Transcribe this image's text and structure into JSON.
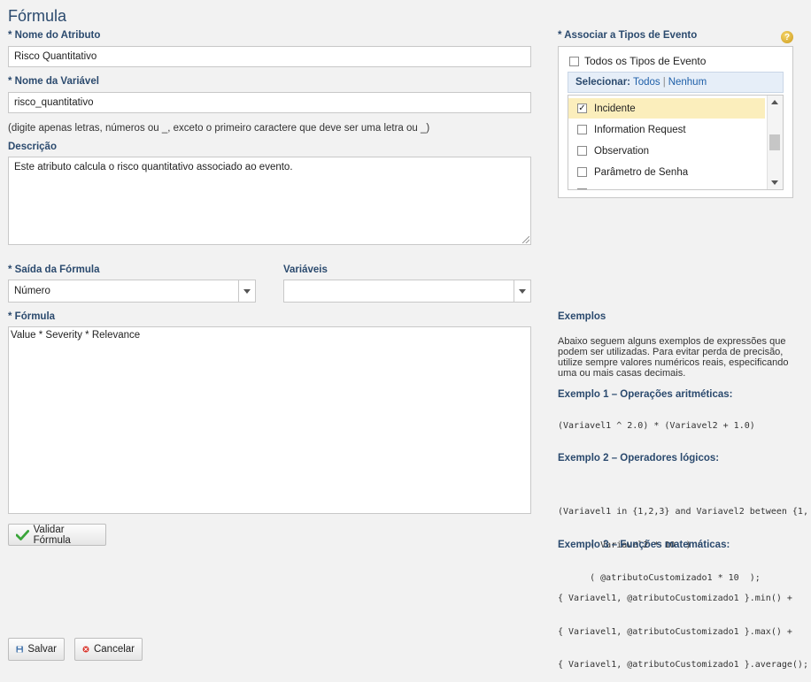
{
  "page": {
    "title": "Fórmula"
  },
  "attr_name": {
    "label": "* Nome do Atributo",
    "value": "Risco Quantitativo"
  },
  "var_name": {
    "label": "* Nome da Variável",
    "value": "risco_quantitativo",
    "hint": "(digite apenas letras, números ou _, exceto o primeiro caractere que deve ser uma letra ou _)"
  },
  "description": {
    "label": "Descrição",
    "value": "Este atributo calcula o risco quantitativo associado ao evento."
  },
  "output": {
    "label": "* Saída da Fórmula",
    "value": "Número"
  },
  "variables": {
    "label": "Variáveis",
    "value": ""
  },
  "formula": {
    "label": "* Fórmula",
    "value": "Value * Severity * Relevance"
  },
  "validate_button": "Validar Fórmula",
  "event_types": {
    "label": "* Associar a Tipos de Evento",
    "all_label": "Todos os Tipos de Evento",
    "select_prefix": "Selecionar:",
    "select_all": "Todos",
    "separator": "|",
    "select_none": "Nenhum",
    "items": [
      {
        "label": "Incidente",
        "checked": true
      },
      {
        "label": "Information Request",
        "checked": false
      },
      {
        "label": "Observation",
        "checked": false
      },
      {
        "label": "Parâmetro de Senha",
        "checked": false
      }
    ]
  },
  "examples": {
    "title": "Exemplos",
    "intro": [
      "Abaixo seguem alguns exemplos de expressões que",
      "podem ser utilizadas. Para evitar perda de precisão,",
      "utilize sempre valores numéricos reais, especificando",
      "uma ou mais casas decimais."
    ],
    "ex1_title": "Exemplo 1 – Operações aritméticas:",
    "ex1_code": [
      "(Variavel1 ^ 2.0) * (Variavel2 + 1.0)"
    ],
    "ex2_title": "Exemplo 2 – Operadores lógicos:",
    "ex2_code": [
      "(Variavel1 in {1,2,3} and Variavel2 between {1,",
      "      ( Variavel2 * 10  ) :",
      "      ( @atributoCustomizado1 * 10  );"
    ],
    "ex3_title": "Exemplo 3 – Funções matemáticas:",
    "ex3_code": [
      "{ Variavel1, @atributoCustomizado1 }.min() +",
      "{ Variavel1, @atributoCustomizado1 }.max() +",
      "{ Variavel1, @atributoCustomizado1 }.average();"
    ]
  },
  "save_button": "Salvar",
  "cancel_button": "Cancelar",
  "icons": {
    "help": "help-icon",
    "check": "check-icon",
    "save": "floppy-disk-icon",
    "cancel": "cancel-icon"
  }
}
